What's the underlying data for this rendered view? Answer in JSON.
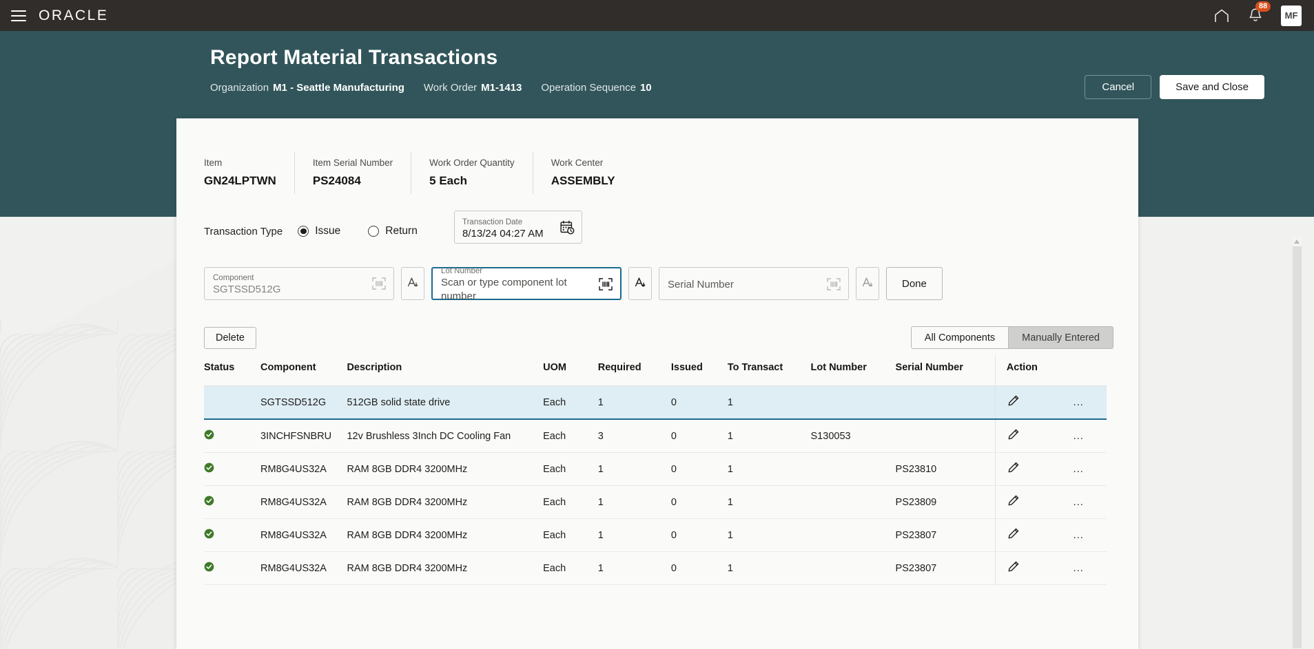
{
  "globalnav": {
    "menu_icon": "hamburger-icon",
    "brand": "ORACLE",
    "home_icon": "home-icon",
    "notifications_icon": "bell-icon",
    "notification_count": "88",
    "avatar_initials": "MF"
  },
  "header": {
    "title": "Report Material Transactions",
    "fields": [
      {
        "label": "Organization",
        "value": "M1 - Seattle Manufacturing"
      },
      {
        "label": "Work Order",
        "value": "M1-1413"
      },
      {
        "label": "Operation Sequence",
        "value": "10"
      }
    ],
    "cancel_label": "Cancel",
    "save_label": "Save and Close"
  },
  "summary": [
    {
      "label": "Item",
      "value": "GN24LPTWN"
    },
    {
      "label": "Item Serial Number",
      "value": "PS24084"
    },
    {
      "label": "Work Order Quantity",
      "value": "5 Each"
    },
    {
      "label": "Work Center",
      "value": "ASSEMBLY"
    }
  ],
  "transaction": {
    "type_label": "Transaction Type",
    "options": [
      {
        "label": "Issue",
        "selected": true
      },
      {
        "label": "Return",
        "selected": false
      }
    ],
    "date_label": "Transaction Date",
    "date_value": "8/13/24 04:27 AM",
    "calendar_icon": "calendar-clock-icon"
  },
  "scan": {
    "component": {
      "label": "Component",
      "value": "SGTSSD512G",
      "scan_icon": "barcode-scan-icon",
      "keyboard_icon": "text-entry-icon"
    },
    "lot": {
      "label": "Lot Number",
      "placeholder": "Scan or type component lot number",
      "value": "",
      "scan_icon": "barcode-scan-icon",
      "keyboard_icon": "text-entry-icon",
      "focused": true
    },
    "serial": {
      "label": "",
      "placeholder": "Serial Number",
      "value": "",
      "scan_icon": "barcode-scan-icon",
      "keyboard_icon": "text-entry-icon"
    },
    "done_label": "Done"
  },
  "tools": {
    "delete_label": "Delete",
    "segments": [
      {
        "label": "All Components",
        "active": false
      },
      {
        "label": "Manually Entered",
        "active": true
      }
    ]
  },
  "table": {
    "columns": [
      "Status",
      "Component",
      "Description",
      "UOM",
      "Required",
      "Issued",
      "To Transact",
      "Lot Number",
      "Serial Number",
      "Action"
    ],
    "edit_icon": "pencil-icon",
    "overflow_label": "...",
    "rows": [
      {
        "status": "",
        "component": "SGTSSD512G",
        "description": "512GB solid state drive",
        "uom": "Each",
        "required": "1",
        "issued": "0",
        "to_transact": "1",
        "lot_number": "",
        "serial_number": "",
        "selected": true
      },
      {
        "status": "complete",
        "component": "3INCHFSNBRU",
        "description": "12v Brushless 3Inch DC Cooling Fan",
        "uom": "Each",
        "required": "3",
        "issued": "0",
        "to_transact": "1",
        "lot_number": "S130053",
        "serial_number": "",
        "selected": false
      },
      {
        "status": "complete",
        "component": "RM8G4US32A",
        "description": "RAM 8GB DDR4 3200MHz",
        "uom": "Each",
        "required": "1",
        "issued": "0",
        "to_transact": "1",
        "lot_number": "",
        "serial_number": "PS23810",
        "selected": false
      },
      {
        "status": "complete",
        "component": "RM8G4US32A",
        "description": "RAM 8GB DDR4 3200MHz",
        "uom": "Each",
        "required": "1",
        "issued": "0",
        "to_transact": "1",
        "lot_number": "",
        "serial_number": "PS23809",
        "selected": false
      },
      {
        "status": "complete",
        "component": "RM8G4US32A",
        "description": "RAM 8GB DDR4 3200MHz",
        "uom": "Each",
        "required": "1",
        "issued": "0",
        "to_transact": "1",
        "lot_number": "",
        "serial_number": "PS23807",
        "selected": false
      },
      {
        "status": "complete",
        "component": "RM8G4US32A",
        "description": "RAM 8GB DDR4 3200MHz",
        "uom": "Each",
        "required": "1",
        "issued": "0",
        "to_transact": "1",
        "lot_number": "",
        "serial_number": "PS23807",
        "selected": false
      }
    ]
  },
  "colors": {
    "nav_bg": "#312d2a",
    "header_teal": "#31555a",
    "accent_blue": "#1b6b8f",
    "status_green": "#3f7a28",
    "badge_orange": "#d9501c",
    "row_selected": "#dfeef5"
  }
}
